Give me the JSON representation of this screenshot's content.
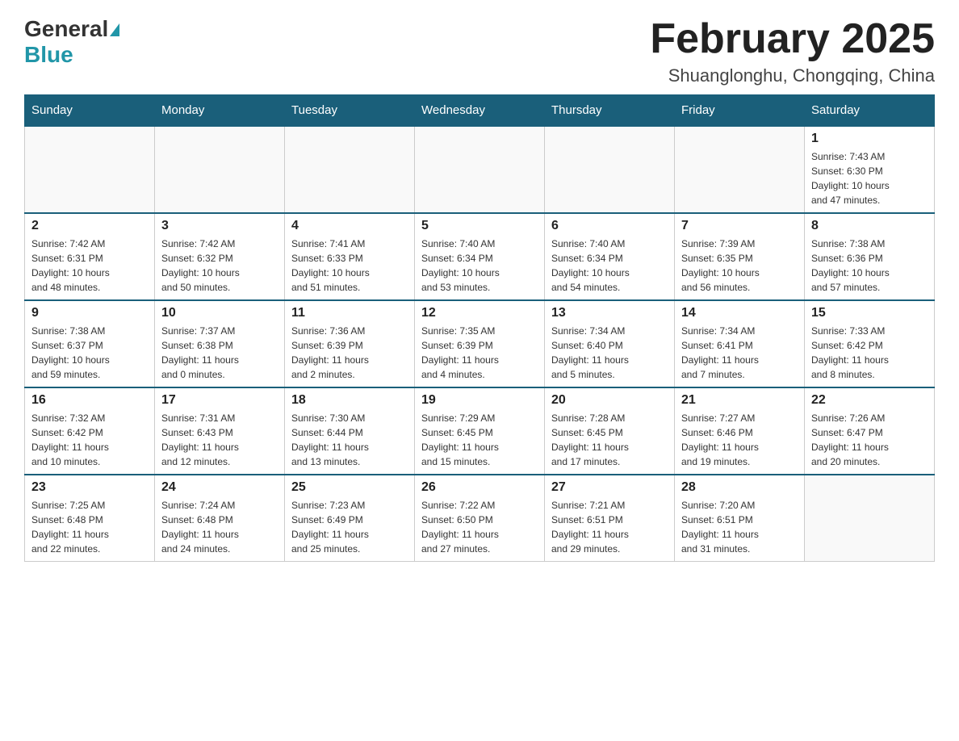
{
  "logo": {
    "general": "General",
    "blue": "Blue"
  },
  "header": {
    "title": "February 2025",
    "subtitle": "Shuanglonghu, Chongqing, China"
  },
  "calendar": {
    "days_of_week": [
      "Sunday",
      "Monday",
      "Tuesday",
      "Wednesday",
      "Thursday",
      "Friday",
      "Saturday"
    ],
    "weeks": [
      [
        {
          "day": "",
          "info": ""
        },
        {
          "day": "",
          "info": ""
        },
        {
          "day": "",
          "info": ""
        },
        {
          "day": "",
          "info": ""
        },
        {
          "day": "",
          "info": ""
        },
        {
          "day": "",
          "info": ""
        },
        {
          "day": "1",
          "info": "Sunrise: 7:43 AM\nSunset: 6:30 PM\nDaylight: 10 hours\nand 47 minutes."
        }
      ],
      [
        {
          "day": "2",
          "info": "Sunrise: 7:42 AM\nSunset: 6:31 PM\nDaylight: 10 hours\nand 48 minutes."
        },
        {
          "day": "3",
          "info": "Sunrise: 7:42 AM\nSunset: 6:32 PM\nDaylight: 10 hours\nand 50 minutes."
        },
        {
          "day": "4",
          "info": "Sunrise: 7:41 AM\nSunset: 6:33 PM\nDaylight: 10 hours\nand 51 minutes."
        },
        {
          "day": "5",
          "info": "Sunrise: 7:40 AM\nSunset: 6:34 PM\nDaylight: 10 hours\nand 53 minutes."
        },
        {
          "day": "6",
          "info": "Sunrise: 7:40 AM\nSunset: 6:34 PM\nDaylight: 10 hours\nand 54 minutes."
        },
        {
          "day": "7",
          "info": "Sunrise: 7:39 AM\nSunset: 6:35 PM\nDaylight: 10 hours\nand 56 minutes."
        },
        {
          "day": "8",
          "info": "Sunrise: 7:38 AM\nSunset: 6:36 PM\nDaylight: 10 hours\nand 57 minutes."
        }
      ],
      [
        {
          "day": "9",
          "info": "Sunrise: 7:38 AM\nSunset: 6:37 PM\nDaylight: 10 hours\nand 59 minutes."
        },
        {
          "day": "10",
          "info": "Sunrise: 7:37 AM\nSunset: 6:38 PM\nDaylight: 11 hours\nand 0 minutes."
        },
        {
          "day": "11",
          "info": "Sunrise: 7:36 AM\nSunset: 6:39 PM\nDaylight: 11 hours\nand 2 minutes."
        },
        {
          "day": "12",
          "info": "Sunrise: 7:35 AM\nSunset: 6:39 PM\nDaylight: 11 hours\nand 4 minutes."
        },
        {
          "day": "13",
          "info": "Sunrise: 7:34 AM\nSunset: 6:40 PM\nDaylight: 11 hours\nand 5 minutes."
        },
        {
          "day": "14",
          "info": "Sunrise: 7:34 AM\nSunset: 6:41 PM\nDaylight: 11 hours\nand 7 minutes."
        },
        {
          "day": "15",
          "info": "Sunrise: 7:33 AM\nSunset: 6:42 PM\nDaylight: 11 hours\nand 8 minutes."
        }
      ],
      [
        {
          "day": "16",
          "info": "Sunrise: 7:32 AM\nSunset: 6:42 PM\nDaylight: 11 hours\nand 10 minutes."
        },
        {
          "day": "17",
          "info": "Sunrise: 7:31 AM\nSunset: 6:43 PM\nDaylight: 11 hours\nand 12 minutes."
        },
        {
          "day": "18",
          "info": "Sunrise: 7:30 AM\nSunset: 6:44 PM\nDaylight: 11 hours\nand 13 minutes."
        },
        {
          "day": "19",
          "info": "Sunrise: 7:29 AM\nSunset: 6:45 PM\nDaylight: 11 hours\nand 15 minutes."
        },
        {
          "day": "20",
          "info": "Sunrise: 7:28 AM\nSunset: 6:45 PM\nDaylight: 11 hours\nand 17 minutes."
        },
        {
          "day": "21",
          "info": "Sunrise: 7:27 AM\nSunset: 6:46 PM\nDaylight: 11 hours\nand 19 minutes."
        },
        {
          "day": "22",
          "info": "Sunrise: 7:26 AM\nSunset: 6:47 PM\nDaylight: 11 hours\nand 20 minutes."
        }
      ],
      [
        {
          "day": "23",
          "info": "Sunrise: 7:25 AM\nSunset: 6:48 PM\nDaylight: 11 hours\nand 22 minutes."
        },
        {
          "day": "24",
          "info": "Sunrise: 7:24 AM\nSunset: 6:48 PM\nDaylight: 11 hours\nand 24 minutes."
        },
        {
          "day": "25",
          "info": "Sunrise: 7:23 AM\nSunset: 6:49 PM\nDaylight: 11 hours\nand 25 minutes."
        },
        {
          "day": "26",
          "info": "Sunrise: 7:22 AM\nSunset: 6:50 PM\nDaylight: 11 hours\nand 27 minutes."
        },
        {
          "day": "27",
          "info": "Sunrise: 7:21 AM\nSunset: 6:51 PM\nDaylight: 11 hours\nand 29 minutes."
        },
        {
          "day": "28",
          "info": "Sunrise: 7:20 AM\nSunset: 6:51 PM\nDaylight: 11 hours\nand 31 minutes."
        },
        {
          "day": "",
          "info": ""
        }
      ]
    ]
  }
}
